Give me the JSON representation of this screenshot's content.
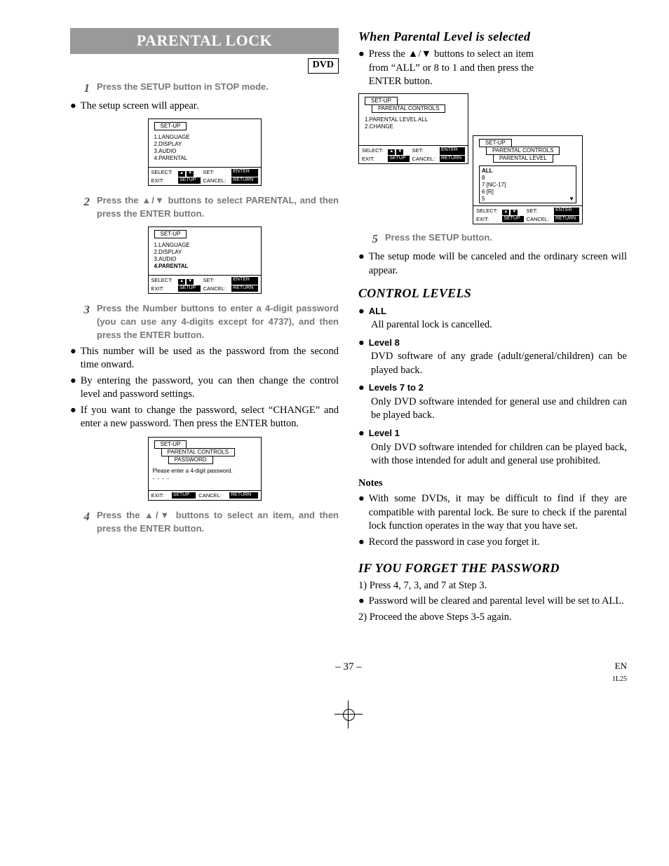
{
  "left": {
    "title": "PARENTAL LOCK",
    "dvd_badge": "DVD",
    "steps": {
      "1": "Press the SETUP button in STOP mode.",
      "1_after": "The setup screen will appear.",
      "2": "Press the ▲/▼ buttons to select PARENTAL, and then press the ENTER button.",
      "3": "Press the Number buttons to enter a 4-digit password (you can use any 4-digits except for  4737), and then press the ENTER button.",
      "3_after": [
        "This number will be used as the password from the second time onward.",
        "By entering the password, you can then change the control level and password settings.",
        "If you want to change the password, select “CHANGE” and enter a new password. Then press the ENTER button."
      ],
      "4": "Press the ▲/▼ buttons to select an item, and then press the ENTER button."
    },
    "screen1": {
      "tab": "SET-UP",
      "items": [
        "1.LANGUAGE",
        "2.DISPLAY",
        "3.AUDIO",
        "4.PARENTAL"
      ],
      "foot": {
        "select": "SELECT:",
        "set": "SET:",
        "exit": "EXIT:",
        "cancel": "CANCEL:",
        "arrows": "▲ ▼",
        "enter": "ENTER",
        "setup": "SETUP",
        "return": "RETURN"
      }
    },
    "screen2": {
      "tab": "SET-UP",
      "items": [
        "1.LANGUAGE",
        "2.DISPLAY",
        "3.AUDIO",
        "4.PARENTAL"
      ],
      "foot": {
        "select": "SELECT:",
        "set": "SET:",
        "exit": "EXIT:",
        "cancel": "CANCEL:",
        "arrows": "▲ ▼",
        "enter": "ENTER",
        "setup": "SETUP",
        "return": "RETURN"
      }
    },
    "screen3": {
      "tab": "SET-UP",
      "tab2": "PARENTAL CONTROLS",
      "tab3": "PASSWORD",
      "msg": "Please enter a 4-digit password.",
      "dots": "- - - -",
      "foot": {
        "exit": "EXIT:",
        "cancel": "CANCEL:",
        "setup": "SETUP",
        "return": "RETURN"
      }
    }
  },
  "right": {
    "h_when": "When Parental Level is selected",
    "when_txt": "Press the ▲/▼ buttons to select an item from “ALL” or 8 to 1 and then press the ENTER button.",
    "screenA": {
      "tab": "SET-UP",
      "tab2": "PARENTAL CONTROLS",
      "items": [
        "1.PARENTAL LEVEL     ALL",
        "2.CHANGE"
      ],
      "foot": {
        "select": "SELECT:",
        "set": "SET:",
        "exit": "EXIT:",
        "cancel": "CANCEL:",
        "arrows": "▲ ▼",
        "enter": "ENTER",
        "setup": "SETUP",
        "return": "RETURN"
      }
    },
    "screenB": {
      "tab": "SET-UP",
      "tab2": "PARENTAL CONTROLS",
      "tab3": "PARENTAL LEVEL",
      "options": [
        "ALL",
        "8",
        "7 [NC-17]",
        "6 [R]",
        "5"
      ],
      "foot": {
        "select": "SELECT:",
        "set": "SET:",
        "exit": "EXIT:",
        "cancel": "CANCEL:",
        "arrows": "▲ ▼",
        "enter": "ENTER",
        "setup": "SETUP",
        "return": "RETURN"
      }
    },
    "step5": "Press the SETUP button.",
    "step5_after": "The setup mode will be canceled and the ordinary screen will appear.",
    "h_levels": "CONTROL LEVELS",
    "levels": [
      {
        "t": "ALL",
        "d": "All parental lock is cancelled."
      },
      {
        "t": "Level 8",
        "d": "DVD software of any grade (adult/general/children) can be played back."
      },
      {
        "t": "Levels 7 to 2",
        "d": "Only DVD software intended for general use and children can be played back."
      },
      {
        "t": "Level 1",
        "d": "Only DVD software intended for children can be played back, with those intended for adult and general use prohibited."
      }
    ],
    "notes_h": "Notes",
    "notes": [
      "With some DVDs, it may be difficult to find if they are compatible with parental lock. Be sure to check if the parental lock function operates in the way that you have set.",
      "Record the password in case you forget it."
    ],
    "h_forget": "IF YOU FORGET THE PASSWORD",
    "forget": [
      "1) Press 4, 7, 3, and 7 at Step 3.",
      "Password will be cleared and parental level will be set to ALL.",
      "2) Proceed the above Steps 3-5 again."
    ]
  },
  "footer": {
    "page": "– 37 –",
    "lang": "EN",
    "code": "1L25"
  }
}
